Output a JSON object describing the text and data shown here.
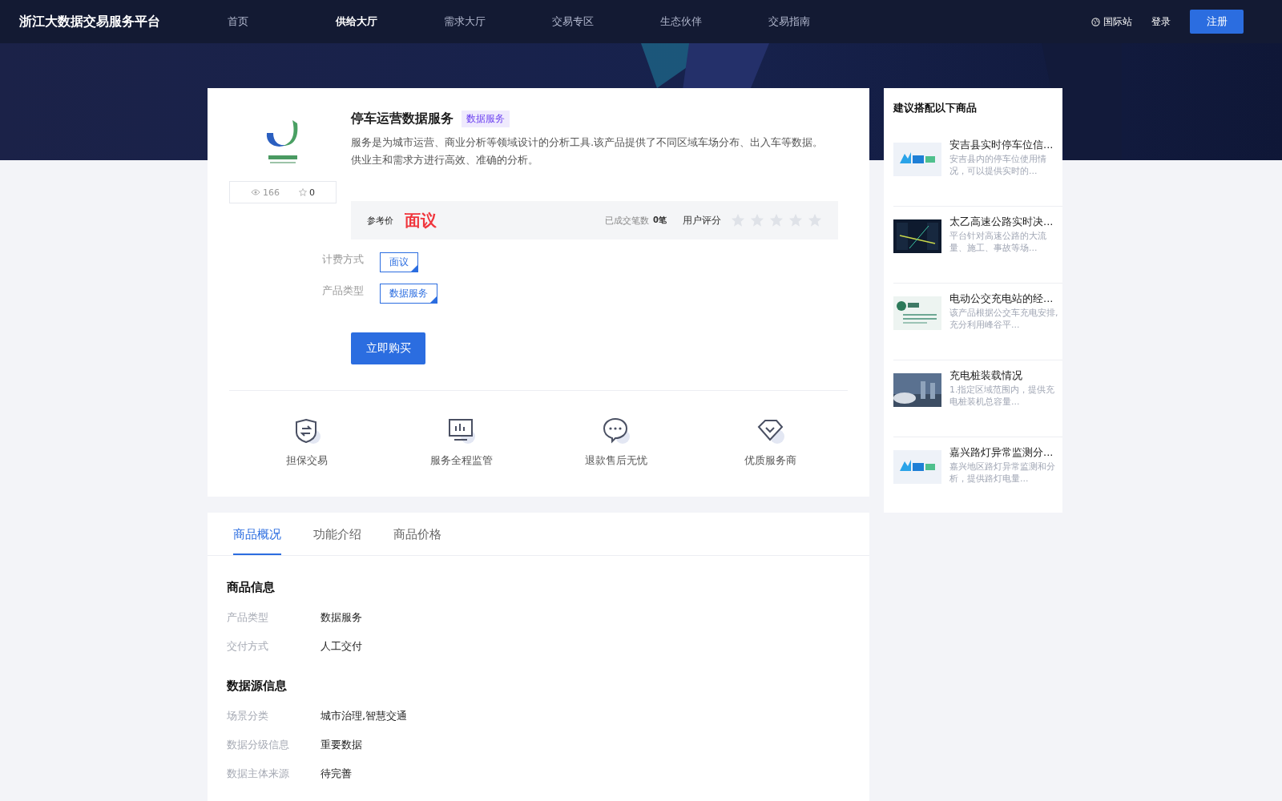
{
  "nav": {
    "logo": "浙江大数据交易服务平台",
    "links": [
      {
        "label": "首页",
        "selected": false
      },
      {
        "label": "供给大厅",
        "selected": true
      },
      {
        "label": "需求大厅",
        "selected": false
      },
      {
        "label": "交易专区",
        "selected": false
      },
      {
        "label": "生态伙伴",
        "selected": false
      },
      {
        "label": "交易指南",
        "selected": false
      }
    ],
    "language": "国际站",
    "login": "登录",
    "register": "注册"
  },
  "product": {
    "title": "停车运营数据服务",
    "tag": "数据服务",
    "description": "服务是为城市运营、商业分析等领域设计的分析工具.该产品提供了不同区域车场分布、出入车等数据。供业主和需求方进行高效、准确的分析。",
    "views": "166",
    "favorites": "0",
    "price_label": "参考价",
    "price": "面议",
    "deals_label": "已成交笔数",
    "deals": "0笔",
    "rating_label": "用户评分",
    "stars": 0,
    "attributes": [
      {
        "label": "计费方式",
        "value": "面议"
      },
      {
        "label": "产品类型",
        "value": "数据服务"
      }
    ],
    "buy_button": "立即购买",
    "guarantees": [
      {
        "kind": "shield",
        "label": "担保交易"
      },
      {
        "kind": "monitor",
        "label": "服务全程监管"
      },
      {
        "kind": "chat",
        "label": "退款售后无忧"
      },
      {
        "kind": "diamond",
        "label": "优质服务商"
      }
    ]
  },
  "sidebar": {
    "title": "建议搭配以下商品",
    "items": [
      {
        "title": "安吉县实时停车位信...",
        "description": "安吉县内的停车位使用情况，可以提供实时的..."
      },
      {
        "title": "太乙高速公路实时决...",
        "description": "平台针对高速公路的大流量、施工、事故等场..."
      },
      {
        "title": "电动公交充电站的经...",
        "description": "该产品根据公交车充电安排,充分利用峰谷平..."
      },
      {
        "title": "充电桩装载情况",
        "description": "1.指定区域范围内，提供充电桩装机总容量..."
      },
      {
        "title": "嘉兴路灯异常监测分...",
        "description": "嘉兴地区路灯异常监测和分析，提供路灯电量..."
      }
    ]
  },
  "details": {
    "tabs": [
      {
        "label": "商品概况",
        "selected": true
      },
      {
        "label": "功能介绍",
        "selected": false
      },
      {
        "label": "商品价格",
        "selected": false
      }
    ],
    "sections": [
      {
        "title": "商品信息",
        "rows": [
          {
            "label": "产品类型",
            "value": "数据服务"
          },
          {
            "label": "交付方式",
            "value": "人工交付"
          }
        ]
      },
      {
        "title": "数据源信息",
        "rows": [
          {
            "label": "场景分类",
            "value": "城市治理,智慧交通"
          },
          {
            "label": "数据分级信息",
            "value": "重要数据"
          },
          {
            "label": "数据主体来源",
            "value": "待完善"
          }
        ]
      }
    ]
  }
}
